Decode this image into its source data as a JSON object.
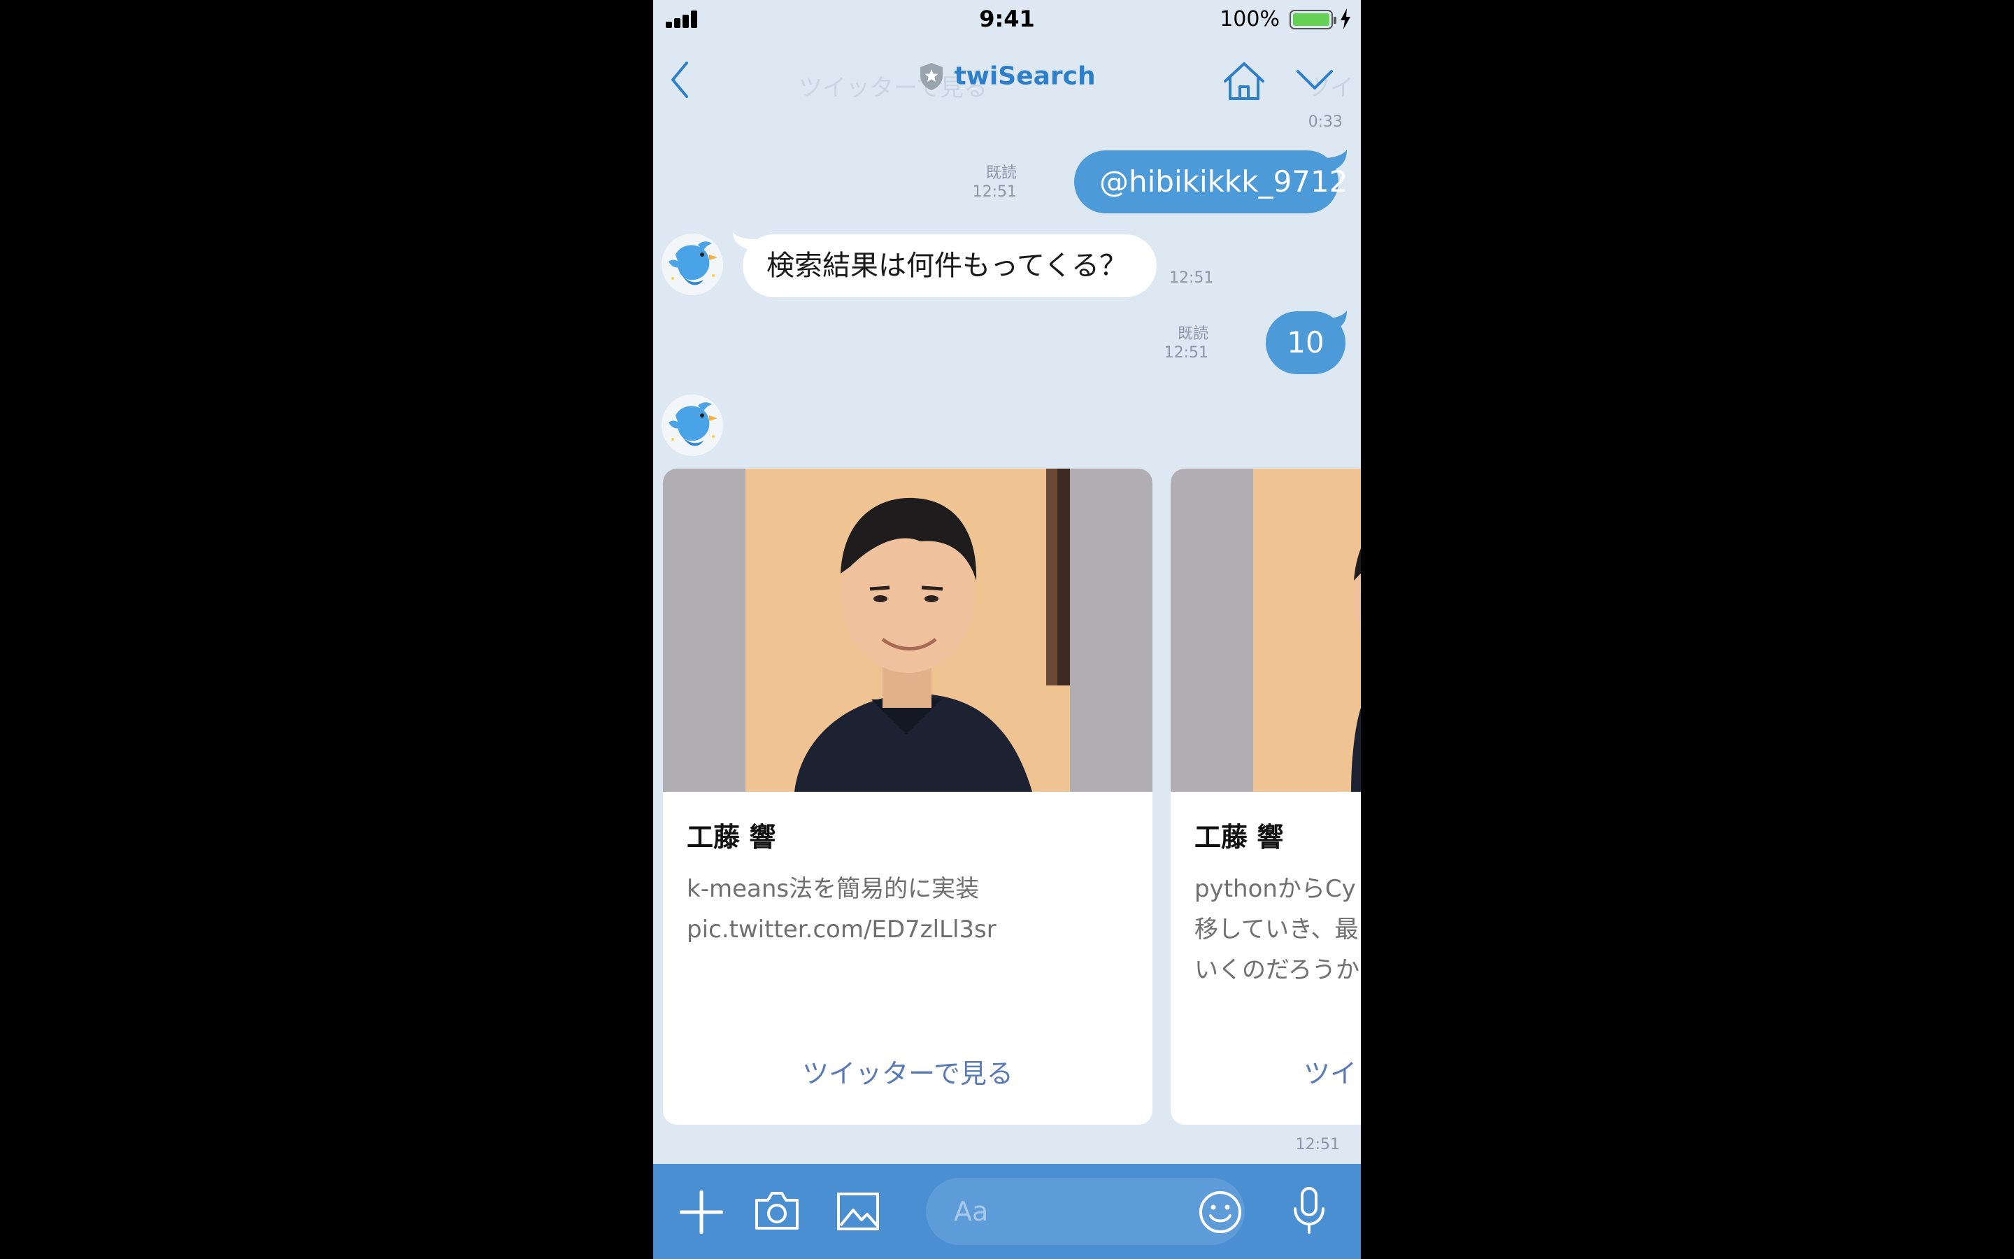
{
  "status_bar": {
    "time": "9:41",
    "battery": "100%"
  },
  "header": {
    "title": "twiSearch",
    "ghost_text": "ツイッターで見る",
    "ghost_text_right": "ツイ"
  },
  "messages": {
    "top_time": "0:33",
    "m1": {
      "text": "@hibikikkk_9712",
      "read": "既読",
      "time": "12:51"
    },
    "m2": {
      "text": "検索結果は何件もってくる？",
      "time": "12:51"
    },
    "m3": {
      "text": "10",
      "read": "既読",
      "time": "12:51"
    }
  },
  "cards": [
    {
      "name": "工藤 響",
      "text": "k-means法を簡易的に実装\npic.twitter.com/ED7zlLl3sr",
      "link": "ツイッターで見る"
    },
    {
      "name": "工藤 響",
      "text": "pythonからCy\n移していき、最\nいくのだろうか",
      "link": "ツイッターで見る"
    }
  ],
  "carousel_time": "12:51",
  "footer": {
    "input_placeholder": "Aa"
  },
  "colors": {
    "accent": "#2d7fca",
    "bubble_me": "#4d9ad9",
    "footer": "#4b8fd3",
    "chat_bg": "#dde8f2"
  },
  "icons": [
    "back-icon",
    "shield-icon",
    "home-icon",
    "chevron-down-icon",
    "plus-icon",
    "camera-icon",
    "image-icon",
    "emoji-icon",
    "microphone-icon"
  ]
}
